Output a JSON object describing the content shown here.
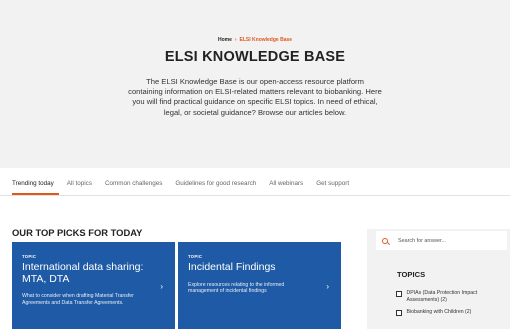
{
  "breadcrumb": {
    "home": "Home",
    "separator": "›",
    "current": "ELSI Knowledge Base"
  },
  "hero": {
    "title": "ELSI KNOWLEDGE BASE",
    "description": "The ELSI Knowledge Base is our open-access resource platform containing information on ELSI-related matters relevant to biobanking. Here you will find practical guidance on specific ELSI topics. In need of ethical, legal, or societal guidance? Browse our articles below."
  },
  "tabs": [
    {
      "label": "Trending today",
      "active": true
    },
    {
      "label": "All topics"
    },
    {
      "label": "Common challenges"
    },
    {
      "label": "Guidelines for good research"
    },
    {
      "label": "All webinars"
    },
    {
      "label": "Get support"
    }
  ],
  "section": {
    "title": "OUR TOP PICKS FOR TODAY"
  },
  "cards": [
    {
      "tag": "TOPIC",
      "title": "International data sharing: MTA, DTA",
      "description": "What to consider when drafting Material Transfer Agreements and Data Transfer Agreements.",
      "arrow": "›"
    },
    {
      "tag": "TOPIC",
      "title": "Incidental Findings",
      "description": "Explore resources relating to the informed management of incidental findings",
      "arrow": "›"
    }
  ],
  "sidebar": {
    "search_placeholder": "Search for answer...",
    "topics_title": "TOPICS",
    "topics": [
      {
        "label": "DPIAs (Data Protection Impact Assessments) (2)"
      },
      {
        "label": "Biobanking with Children (2)"
      }
    ]
  },
  "colors": {
    "accent": "#e0581a",
    "card": "#1e5aa5",
    "hero_bg": "#f2f2f2"
  }
}
